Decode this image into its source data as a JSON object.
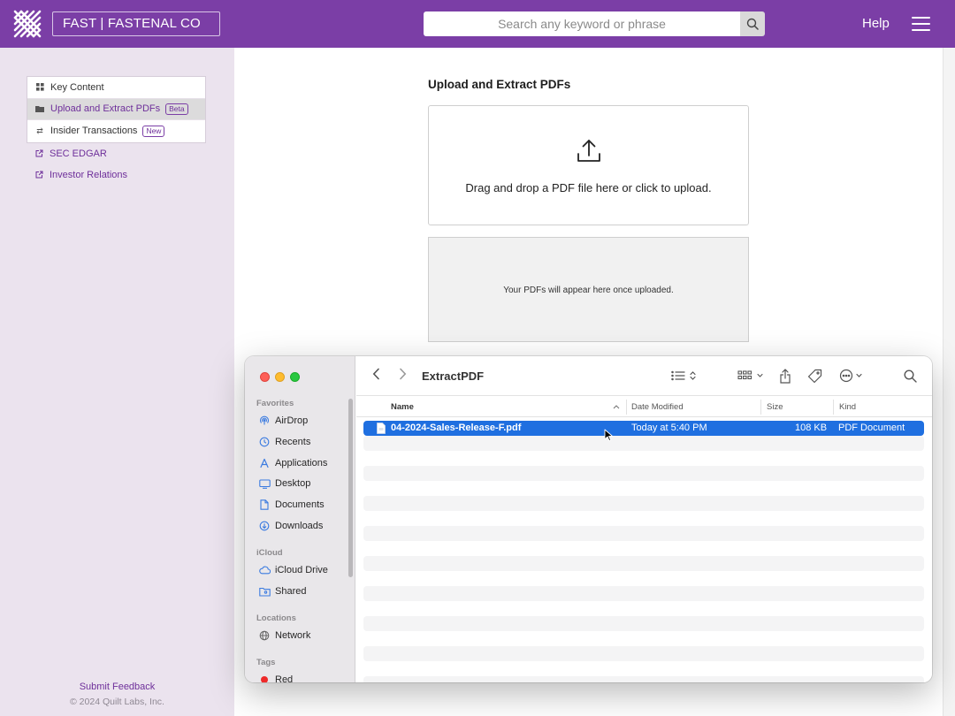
{
  "topbar": {
    "ticker_label": "FAST | FASTENAL CO",
    "search_placeholder": "Search any keyword or phrase",
    "help_label": "Help",
    "brand_color": "#7b3ea6"
  },
  "sidebar": {
    "nav_items": [
      {
        "label": "Key Content",
        "icon": "grid-icon",
        "badge": ""
      },
      {
        "label": "Upload and Extract PDFs",
        "icon": "folder-icon",
        "badge": "Beta",
        "active": true
      },
      {
        "label": "Insider Transactions",
        "icon": "swap-arrows-icon",
        "badge": "New"
      }
    ],
    "external_links": [
      {
        "label": "SEC EDGAR",
        "icon": "external-link-icon"
      },
      {
        "label": "Investor Relations",
        "icon": "external-link-icon"
      }
    ],
    "feedback_label": "Submit Feedback",
    "copyright": "© 2024 Quilt Labs, Inc."
  },
  "main": {
    "title": "Upload and Extract PDFs",
    "dropzone_text": "Drag and drop a PDF file here or click to upload.",
    "empty_list_text": "Your PDFs will appear here once uploaded."
  },
  "finder": {
    "folder_title": "ExtractPDF",
    "sidebar_sections": [
      {
        "heading": "Favorites",
        "items": [
          "AirDrop",
          "Recents",
          "Applications",
          "Desktop",
          "Documents",
          "Downloads"
        ]
      },
      {
        "heading": "iCloud",
        "items": [
          "iCloud Drive",
          "Shared"
        ]
      },
      {
        "heading": "Locations",
        "items": [
          "Network"
        ]
      },
      {
        "heading": "Tags",
        "items": [
          "Red"
        ]
      }
    ],
    "columns": {
      "name": "Name",
      "date": "Date Modified",
      "size": "Size",
      "kind": "Kind"
    },
    "files": [
      {
        "name": "04-2024-Sales-Release-F.pdf",
        "date": "Today at 5:40 PM",
        "size": "108 KB",
        "kind": "PDF Document",
        "selected": true
      }
    ],
    "selection_color": "#1f6fe0"
  }
}
